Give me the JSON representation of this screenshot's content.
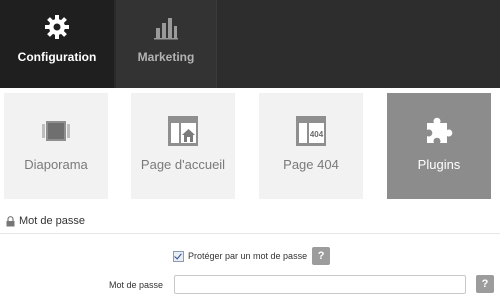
{
  "top_tabs": [
    {
      "label": "Configuration",
      "icon": "gear-icon",
      "active": true
    },
    {
      "label": "Marketing",
      "icon": "bar-chart-icon",
      "active": false
    }
  ],
  "sub_tabs": [
    {
      "label": "Diaporama",
      "icon": "slideshow-icon",
      "active": false
    },
    {
      "label": "Page d'accueil",
      "icon": "home-page-icon",
      "active": false
    },
    {
      "label": "Page 404",
      "icon": "page-404-icon",
      "icon_text": "404",
      "active": false
    },
    {
      "label": "Plugins",
      "icon": "puzzle-icon",
      "active": true
    }
  ],
  "section": {
    "title": "Mot de passe",
    "icon": "lock-icon"
  },
  "form": {
    "protect_checkbox": {
      "label": "Protéger par un mot de passe",
      "checked": true
    },
    "password_label": "Mot de passe",
    "password_value": "",
    "help_label": "?"
  },
  "colors": {
    "topbar_bg": "#2b2b2b",
    "active_tile_bg": "#8c8c8c",
    "tile_bg": "#f2f2f2",
    "help_bg": "#9c9c9c"
  }
}
